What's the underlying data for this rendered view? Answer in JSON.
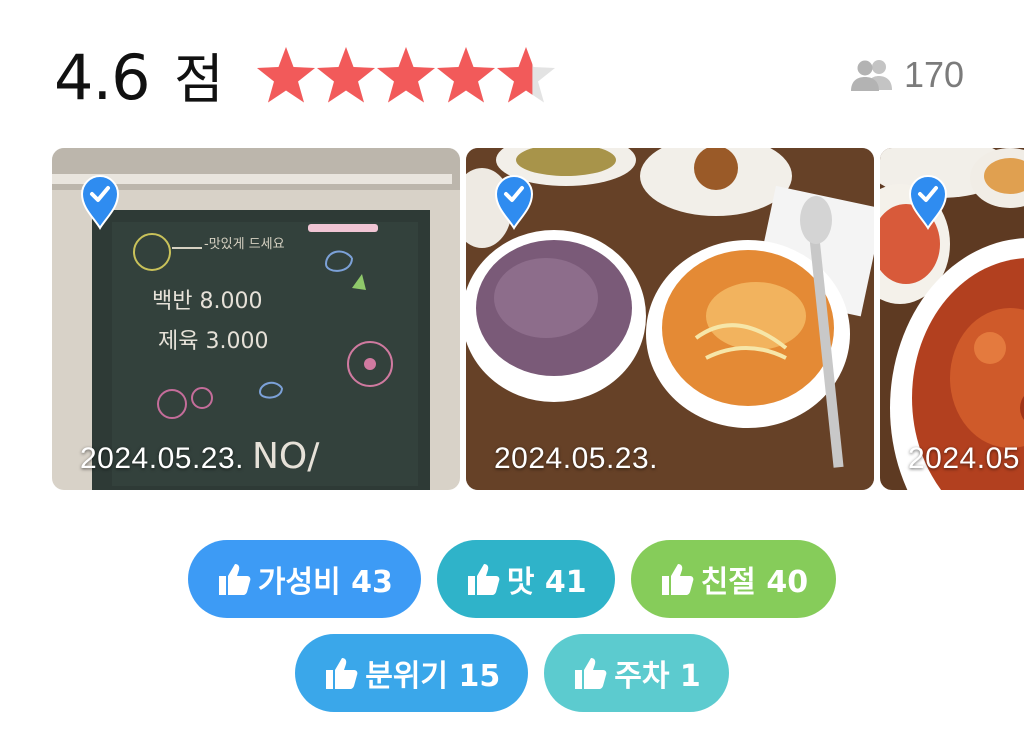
{
  "rating": {
    "score": "4.6",
    "unit": "점",
    "stars_value": 4.6,
    "stars_max": 5,
    "star_color": "#f25a5a",
    "star_empty_color": "#e3e3e3",
    "reviewer_icon": "people-icon",
    "reviewer_count": "170"
  },
  "photos": [
    {
      "date": "2024.05.23.",
      "subject": "chalkboard-menu",
      "verified_icon": "verified-badge-icon"
    },
    {
      "date": "2024.05.23.",
      "subject": "rice-and-soup",
      "verified_icon": "verified-badge-icon"
    },
    {
      "date": "2024.05",
      "subject": "spicy-pork",
      "verified_icon": "verified-badge-icon"
    }
  ],
  "tags": [
    {
      "label": "가성비 43",
      "color": "#3d9bf5",
      "icon": "thumbs-up-icon"
    },
    {
      "label": "맛 41",
      "color": "#2fb3c9",
      "icon": "thumbs-up-icon"
    },
    {
      "label": "친절 40",
      "color": "#86cc5a",
      "icon": "thumbs-up-icon"
    },
    {
      "label": "분위기 15",
      "color": "#3aa7ea",
      "icon": "thumbs-up-icon"
    },
    {
      "label": "주차 1",
      "color": "#5ccbcf",
      "icon": "thumbs-up-icon"
    }
  ]
}
